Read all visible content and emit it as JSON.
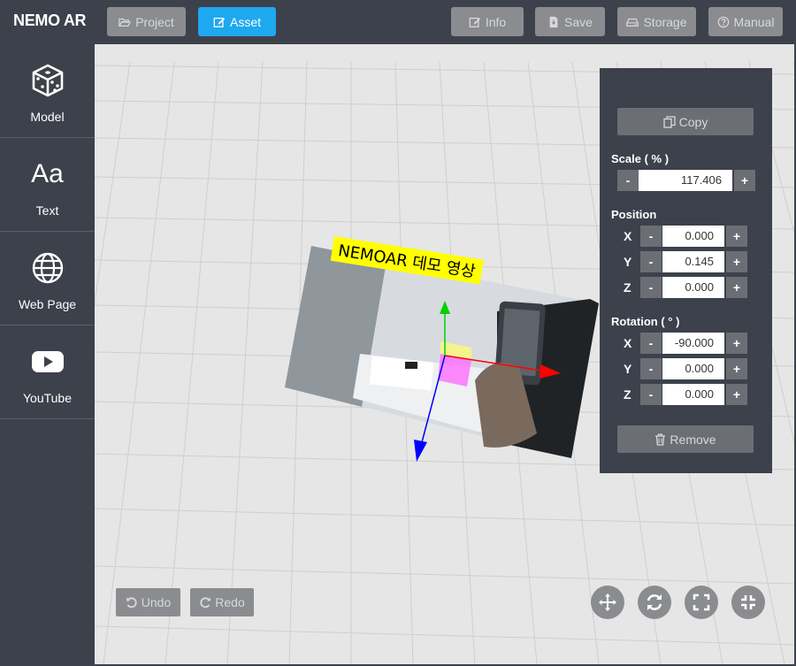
{
  "app": {
    "brand": "NEMO AR"
  },
  "toolbar": {
    "project_label": "Project",
    "asset_label": "Asset",
    "info_label": "Info",
    "save_label": "Save",
    "storage_label": "Storage",
    "manual_label": "Manual"
  },
  "sidebar": {
    "items": [
      {
        "label": "Model",
        "icon": "dice-cube-icon"
      },
      {
        "label": "Text",
        "icon": "text-aa-icon"
      },
      {
        "label": "Web Page",
        "icon": "globe-icon"
      },
      {
        "label": "YouTube",
        "icon": "youtube-icon"
      }
    ]
  },
  "scene": {
    "asset_caption": "NEMOAR 데모 영상",
    "colors": {
      "x_axis": "#ff0000",
      "y_axis": "#00d000",
      "z_axis": "#0000ff",
      "caption_bg": "#ffff00"
    }
  },
  "panel": {
    "copy_label": "Copy",
    "scale_label": "Scale ( % )",
    "scale_value": "117.406",
    "position_label": "Position",
    "position": {
      "x": "0.000",
      "y": "0.145",
      "z": "0.000"
    },
    "rotation_label": "Rotation ( ° )",
    "rotation": {
      "x": "-90.000",
      "y": "0.000",
      "z": "0.000"
    },
    "axis_labels": {
      "x": "X",
      "y": "Y",
      "z": "Z"
    },
    "minus": "-",
    "plus": "+",
    "remove_label": "Remove"
  },
  "bottom": {
    "undo_label": "Undo",
    "redo_label": "Redo",
    "controls": [
      "move-icon",
      "rotate-icon",
      "expand-icon",
      "compress-icon"
    ]
  },
  "colors": {
    "accent": "#1ea8f0",
    "chrome": "#3c414b",
    "button_gray": "#8b8c8f"
  }
}
